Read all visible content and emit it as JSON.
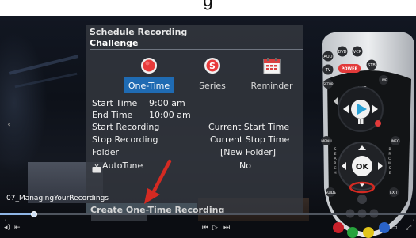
{
  "dialog": {
    "title": "Schedule Recording",
    "subtitle": "Challenge",
    "options": [
      {
        "label": "One-Time",
        "icon": "record-icon",
        "selected": true
      },
      {
        "label": "Series",
        "icon": "series-icon",
        "selected": false
      },
      {
        "label": "Reminder",
        "icon": "calendar-icon",
        "selected": false
      }
    ],
    "fields": [
      {
        "label": "Start Time",
        "value": "9:00 am"
      },
      {
        "label": "End Time",
        "value": "10:00 am"
      },
      {
        "label": "Start Recording",
        "value": "Current Start Time"
      },
      {
        "label": "Stop Recording",
        "value": "Current Stop Time"
      },
      {
        "label": "Folder",
        "value": "[New Folder]"
      },
      {
        "label": "AutoTune",
        "value": "No"
      }
    ],
    "create_label": "Create One-Time Recording"
  },
  "remote": {
    "buttons": [
      "AUD",
      "DVD",
      "VCR",
      "TV",
      "POWER",
      "STB",
      "SETUP",
      "LIVE",
      "LIST",
      "MENU",
      "INFO",
      "OK",
      "GUIDE",
      "EXIT"
    ],
    "side_labels": [
      "SEARCH",
      "BROWSE"
    ]
  },
  "player": {
    "caption": "07_ManagingYourRecordings",
    "progress_fraction": 0.08
  },
  "colors": {
    "dialog_bg": "#343840",
    "highlight_blue": "#1f6bb3",
    "record_red": "#e83a3a",
    "arrow_red": "#d42a22"
  }
}
